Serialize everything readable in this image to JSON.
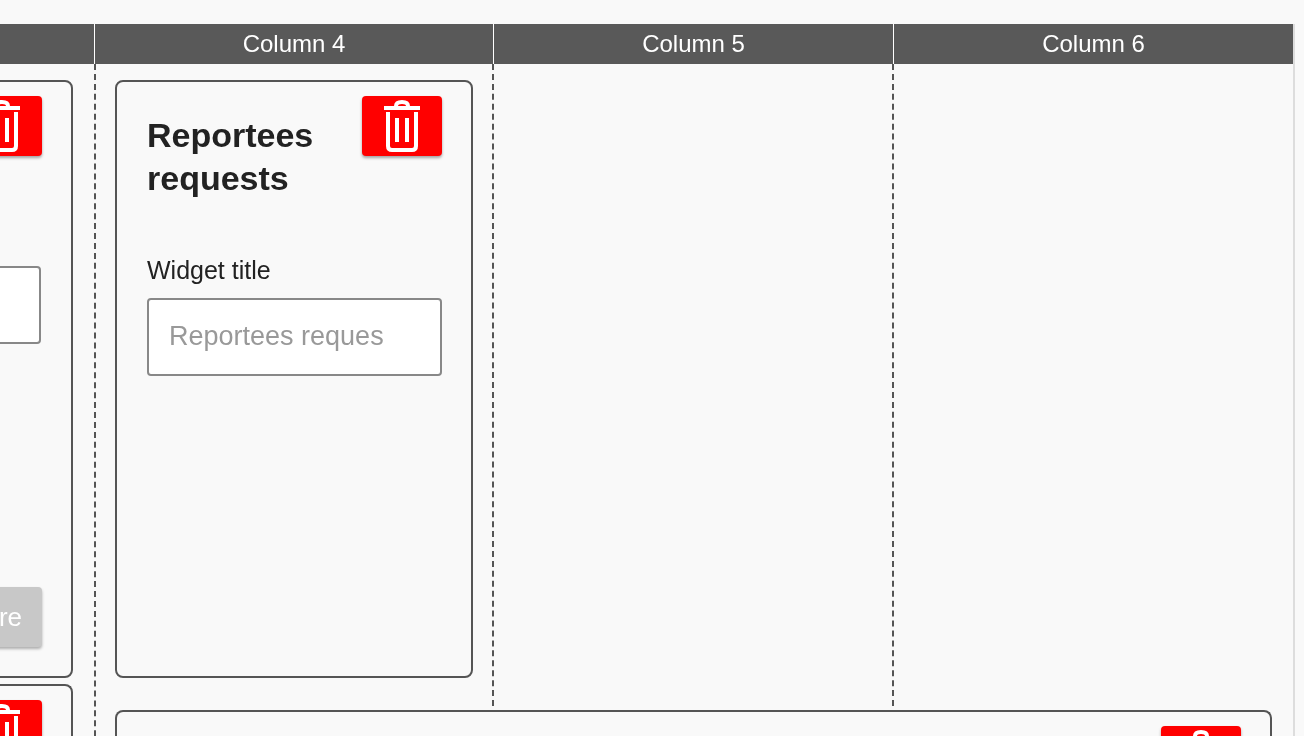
{
  "columns": [
    {},
    {
      "label": "Column 4"
    },
    {
      "label": "Column 5"
    },
    {
      "label": "Column 6"
    }
  ],
  "cards": [
    {
      "kind": "partial",
      "button": "re"
    },
    {
      "kind": "form",
      "title": "Reportees requests",
      "field_label": "Widget title",
      "placeholder": "Reportees reques"
    }
  ],
  "bottom_cards": [
    {
      "kind": "partial"
    },
    {
      "kind": "wide"
    }
  ]
}
